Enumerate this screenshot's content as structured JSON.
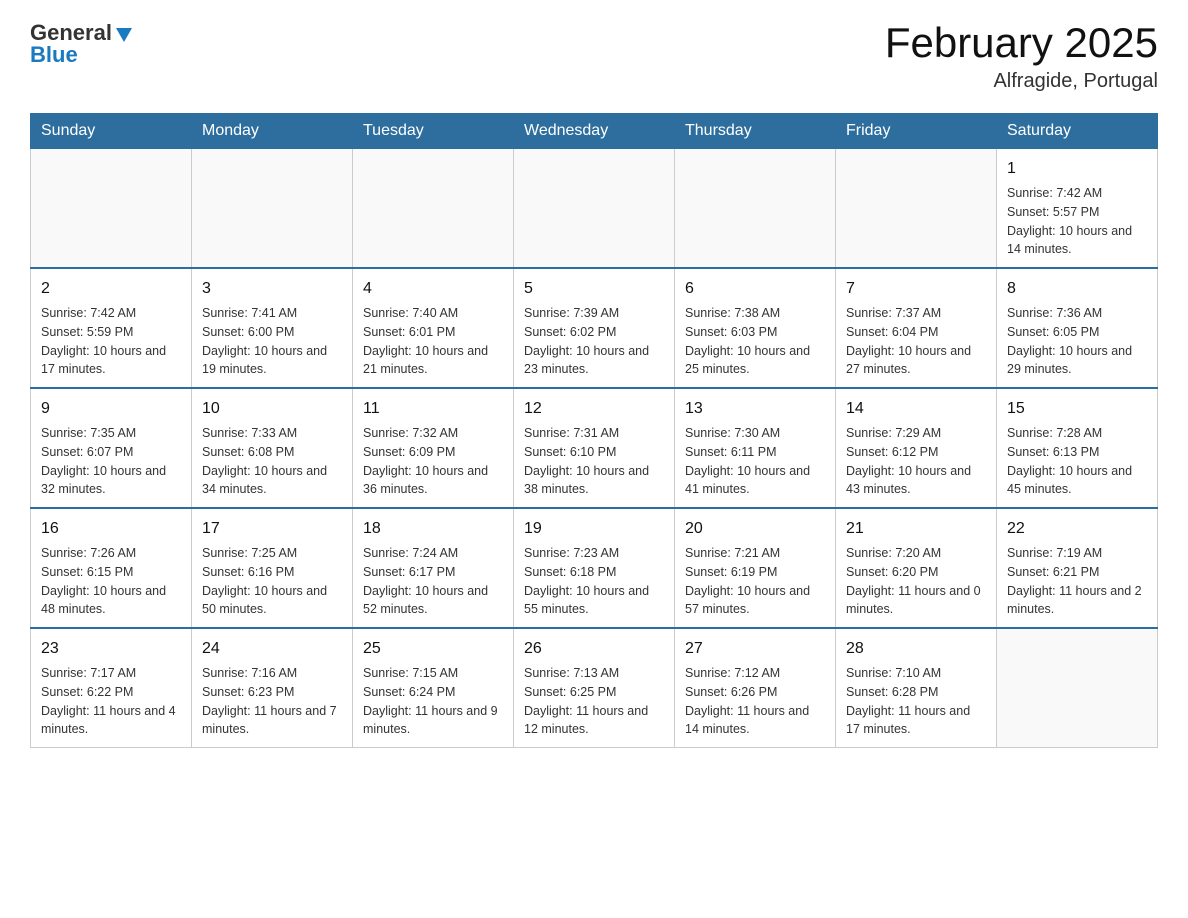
{
  "header": {
    "logo_general": "General",
    "logo_blue": "Blue",
    "title": "February 2025",
    "subtitle": "Alfragide, Portugal"
  },
  "weekdays": [
    "Sunday",
    "Monday",
    "Tuesday",
    "Wednesday",
    "Thursday",
    "Friday",
    "Saturday"
  ],
  "weeks": [
    [
      {
        "day": "",
        "info": ""
      },
      {
        "day": "",
        "info": ""
      },
      {
        "day": "",
        "info": ""
      },
      {
        "day": "",
        "info": ""
      },
      {
        "day": "",
        "info": ""
      },
      {
        "day": "",
        "info": ""
      },
      {
        "day": "1",
        "info": "Sunrise: 7:42 AM\nSunset: 5:57 PM\nDaylight: 10 hours and 14 minutes."
      }
    ],
    [
      {
        "day": "2",
        "info": "Sunrise: 7:42 AM\nSunset: 5:59 PM\nDaylight: 10 hours and 17 minutes."
      },
      {
        "day": "3",
        "info": "Sunrise: 7:41 AM\nSunset: 6:00 PM\nDaylight: 10 hours and 19 minutes."
      },
      {
        "day": "4",
        "info": "Sunrise: 7:40 AM\nSunset: 6:01 PM\nDaylight: 10 hours and 21 minutes."
      },
      {
        "day": "5",
        "info": "Sunrise: 7:39 AM\nSunset: 6:02 PM\nDaylight: 10 hours and 23 minutes."
      },
      {
        "day": "6",
        "info": "Sunrise: 7:38 AM\nSunset: 6:03 PM\nDaylight: 10 hours and 25 minutes."
      },
      {
        "day": "7",
        "info": "Sunrise: 7:37 AM\nSunset: 6:04 PM\nDaylight: 10 hours and 27 minutes."
      },
      {
        "day": "8",
        "info": "Sunrise: 7:36 AM\nSunset: 6:05 PM\nDaylight: 10 hours and 29 minutes."
      }
    ],
    [
      {
        "day": "9",
        "info": "Sunrise: 7:35 AM\nSunset: 6:07 PM\nDaylight: 10 hours and 32 minutes."
      },
      {
        "day": "10",
        "info": "Sunrise: 7:33 AM\nSunset: 6:08 PM\nDaylight: 10 hours and 34 minutes."
      },
      {
        "day": "11",
        "info": "Sunrise: 7:32 AM\nSunset: 6:09 PM\nDaylight: 10 hours and 36 minutes."
      },
      {
        "day": "12",
        "info": "Sunrise: 7:31 AM\nSunset: 6:10 PM\nDaylight: 10 hours and 38 minutes."
      },
      {
        "day": "13",
        "info": "Sunrise: 7:30 AM\nSunset: 6:11 PM\nDaylight: 10 hours and 41 minutes."
      },
      {
        "day": "14",
        "info": "Sunrise: 7:29 AM\nSunset: 6:12 PM\nDaylight: 10 hours and 43 minutes."
      },
      {
        "day": "15",
        "info": "Sunrise: 7:28 AM\nSunset: 6:13 PM\nDaylight: 10 hours and 45 minutes."
      }
    ],
    [
      {
        "day": "16",
        "info": "Sunrise: 7:26 AM\nSunset: 6:15 PM\nDaylight: 10 hours and 48 minutes."
      },
      {
        "day": "17",
        "info": "Sunrise: 7:25 AM\nSunset: 6:16 PM\nDaylight: 10 hours and 50 minutes."
      },
      {
        "day": "18",
        "info": "Sunrise: 7:24 AM\nSunset: 6:17 PM\nDaylight: 10 hours and 52 minutes."
      },
      {
        "day": "19",
        "info": "Sunrise: 7:23 AM\nSunset: 6:18 PM\nDaylight: 10 hours and 55 minutes."
      },
      {
        "day": "20",
        "info": "Sunrise: 7:21 AM\nSunset: 6:19 PM\nDaylight: 10 hours and 57 minutes."
      },
      {
        "day": "21",
        "info": "Sunrise: 7:20 AM\nSunset: 6:20 PM\nDaylight: 11 hours and 0 minutes."
      },
      {
        "day": "22",
        "info": "Sunrise: 7:19 AM\nSunset: 6:21 PM\nDaylight: 11 hours and 2 minutes."
      }
    ],
    [
      {
        "day": "23",
        "info": "Sunrise: 7:17 AM\nSunset: 6:22 PM\nDaylight: 11 hours and 4 minutes."
      },
      {
        "day": "24",
        "info": "Sunrise: 7:16 AM\nSunset: 6:23 PM\nDaylight: 11 hours and 7 minutes."
      },
      {
        "day": "25",
        "info": "Sunrise: 7:15 AM\nSunset: 6:24 PM\nDaylight: 11 hours and 9 minutes."
      },
      {
        "day": "26",
        "info": "Sunrise: 7:13 AM\nSunset: 6:25 PM\nDaylight: 11 hours and 12 minutes."
      },
      {
        "day": "27",
        "info": "Sunrise: 7:12 AM\nSunset: 6:26 PM\nDaylight: 11 hours and 14 minutes."
      },
      {
        "day": "28",
        "info": "Sunrise: 7:10 AM\nSunset: 6:28 PM\nDaylight: 11 hours and 17 minutes."
      },
      {
        "day": "",
        "info": ""
      }
    ]
  ]
}
